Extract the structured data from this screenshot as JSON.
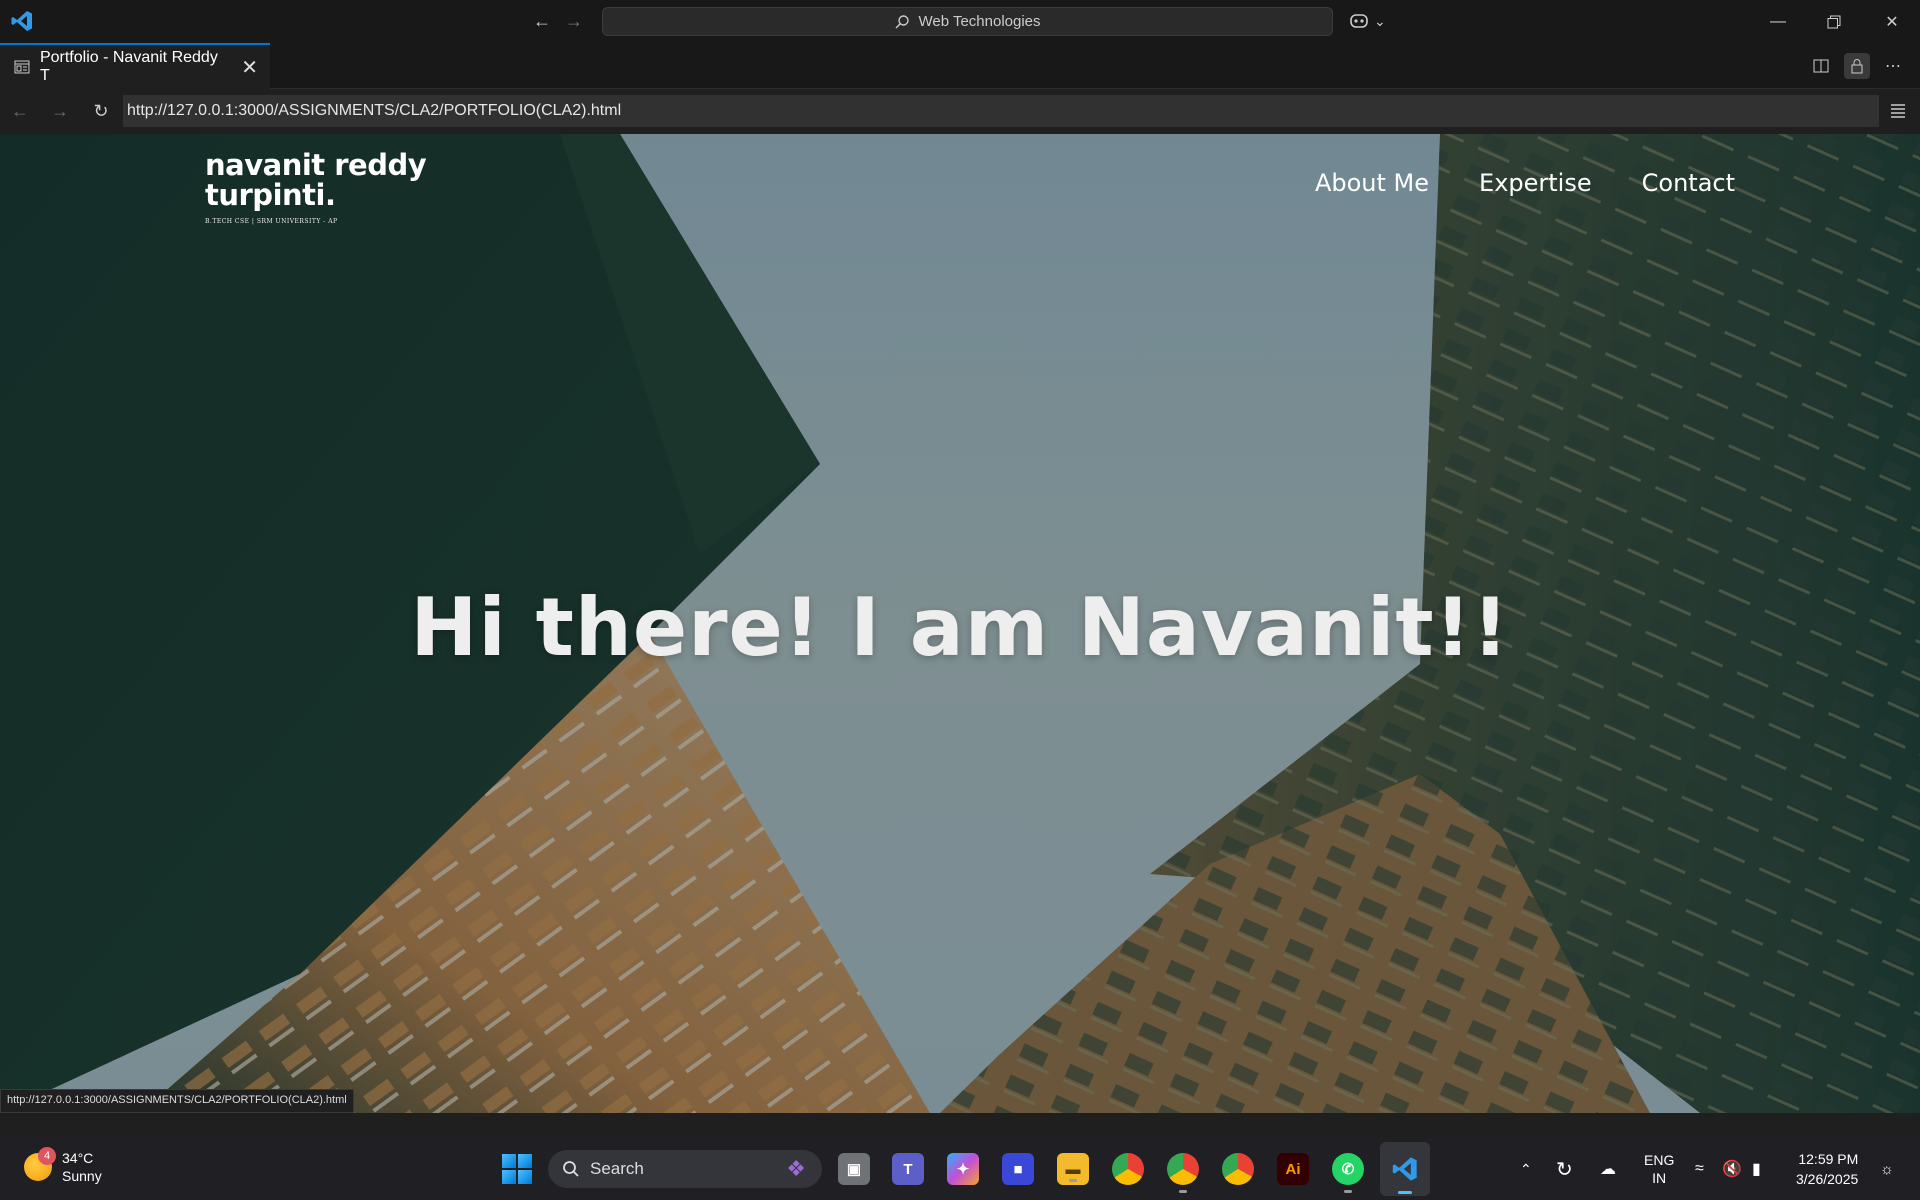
{
  "window": {
    "search_text": "Web Technologies"
  },
  "tab": {
    "title": "Portfolio - Navanit Reddy T"
  },
  "address_bar": {
    "url": "http://127.0.0.1:3000/ASSIGNMENTS/CLA2/PORTFOLIO(CLA2).html"
  },
  "page": {
    "brand_name": "navanit reddy turpinti.",
    "brand_tagline": "B.TECH CSE | SRM UNIVERSITY - AP",
    "nav": [
      "About Me",
      "Expertise",
      "Contact"
    ],
    "hero_title": "Hi there! I am Navanit!!",
    "status_url": "http://127.0.0.1:3000/ASSIGNMENTS/CLA2/PORTFOLIO(CLA2).html"
  },
  "taskbar": {
    "weather_badge": "4",
    "temperature": "34°C",
    "condition": "Sunny",
    "search_label": "Search",
    "lang_top": "ENG",
    "lang_bottom": "IN",
    "time": "12:59 PM",
    "date": "3/26/2025"
  },
  "colors": {
    "accent": "#0078d4",
    "titlebar": "#181818",
    "editor_bg": "#1f1f1f",
    "taskbar": "#202024"
  }
}
